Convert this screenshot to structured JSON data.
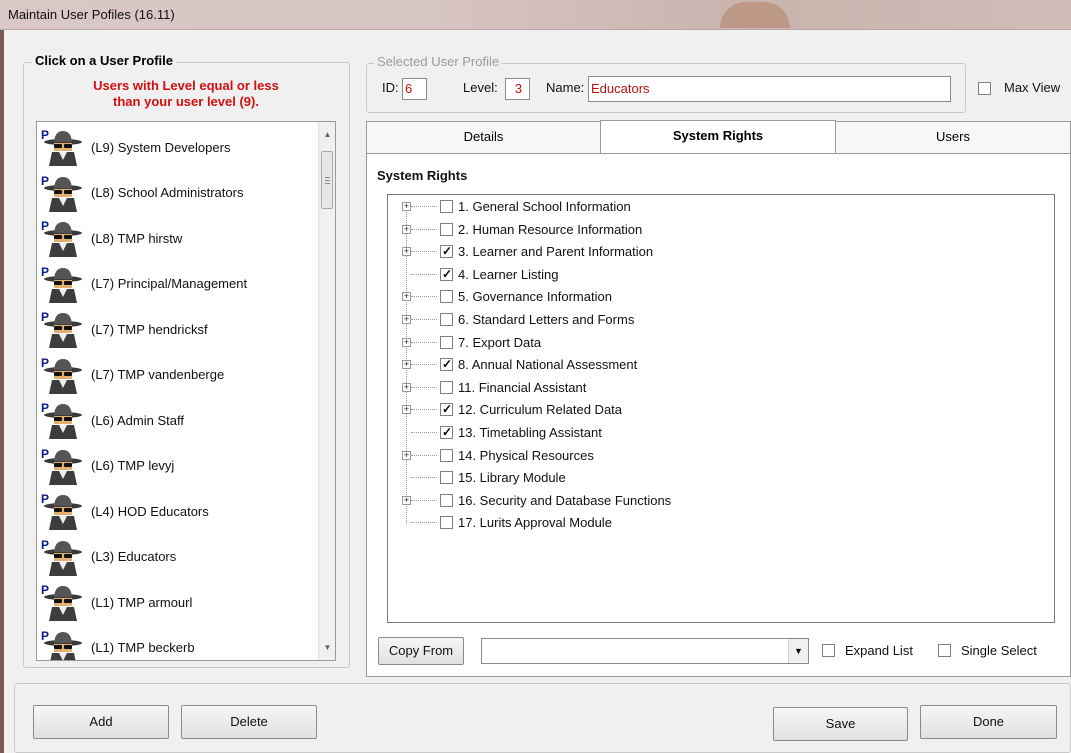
{
  "window": {
    "title": "Maintain User Pofiles (16.11)"
  },
  "profiles": {
    "group_label": "Click on a User Profile",
    "warning_line1": "Users with Level equal or less",
    "warning_line2": "than your user level (9).",
    "items": [
      {
        "label": "(L9) System Developers"
      },
      {
        "label": "(L8) School Administrators"
      },
      {
        "label": "(L8) TMP hirstw"
      },
      {
        "label": "(L7) Principal/Management"
      },
      {
        "label": "(L7) TMP hendricksf"
      },
      {
        "label": "(L7) TMP vandenberge"
      },
      {
        "label": "(L6) Admin Staff"
      },
      {
        "label": "(L6) TMP levyj"
      },
      {
        "label": "(L4) HOD Educators"
      },
      {
        "label": "(L3) Educators"
      },
      {
        "label": "(L1) TMP armourl"
      },
      {
        "label": "(L1) TMP beckerb"
      }
    ]
  },
  "selected": {
    "group_label": "Selected User Profile",
    "id_label": "ID:",
    "id_value": "6",
    "level_label": "Level:",
    "level_value": "3",
    "name_label": "Name:",
    "name_value": "Educators"
  },
  "max_view": {
    "label": "Max View",
    "checked": false
  },
  "tabs": [
    {
      "label": "Details",
      "active": false
    },
    {
      "label": "System Rights",
      "active": true
    },
    {
      "label": "Users",
      "active": false
    }
  ],
  "rights": {
    "heading": "System Rights",
    "items": [
      {
        "label": "1. General School Information",
        "checked": false,
        "expandable": true
      },
      {
        "label": "2. Human Resource Information",
        "checked": false,
        "expandable": true
      },
      {
        "label": "3. Learner and Parent Information",
        "checked": true,
        "expandable": true
      },
      {
        "label": "4. Learner Listing",
        "checked": true,
        "expandable": false
      },
      {
        "label": "5. Governance Information",
        "checked": false,
        "expandable": true
      },
      {
        "label": "6. Standard Letters and Forms",
        "checked": false,
        "expandable": true
      },
      {
        "label": "7. Export Data",
        "checked": false,
        "expandable": true
      },
      {
        "label": "8. Annual National Assessment",
        "checked": true,
        "expandable": true
      },
      {
        "label": "11. Financial Assistant",
        "checked": false,
        "expandable": true
      },
      {
        "label": "12. Curriculum Related Data",
        "checked": true,
        "expandable": true
      },
      {
        "label": "13. Timetabling Assistant",
        "checked": true,
        "expandable": false
      },
      {
        "label": "14. Physical Resources",
        "checked": false,
        "expandable": true
      },
      {
        "label": "15. Library Module",
        "checked": false,
        "expandable": false
      },
      {
        "label": "16. Security and Database Functions",
        "checked": false,
        "expandable": true
      },
      {
        "label": "17. Lurits Approval Module",
        "checked": false,
        "expandable": false
      }
    ]
  },
  "bottom_bar": {
    "copy_from": "Copy From",
    "expand_list": "Expand List",
    "single_select": "Single Select"
  },
  "footer": {
    "add": "Add",
    "delete": "Delete",
    "save": "Save",
    "done": "Done"
  }
}
